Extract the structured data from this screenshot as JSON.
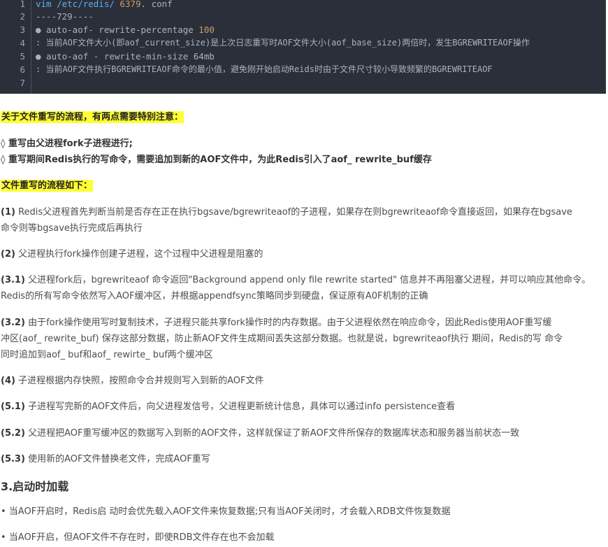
{
  "code": {
    "lines": [
      {
        "no": "1",
        "cmd": "vim /etc/redis/ ",
        "num": "6379",
        "rest": ". conf"
      },
      {
        "no": "2",
        "text": "----729----"
      },
      {
        "no": "3",
        "pre": "● auto-aof- rewrite-percentage ",
        "num": "100"
      },
      {
        "no": "4",
        "text": ": 当前AOF文件大小(即aof_current_size)是上次日志重写时AOF文件大小(aof_base_size)两倍时，发生BGREWRITEAOF操作"
      },
      {
        "no": "5",
        "text": "● auto-aof - rewrite-min-size 64mb"
      },
      {
        "no": "6",
        "text": ": 当前AOF文件执行BGREWRITEAOF命令的最小值，避免刚开始启动Reids时由于文件尺寸较小导致频繁的BGREWRITEAOF"
      },
      {
        "no": "7",
        "text": ""
      }
    ]
  },
  "notice_heading": "关于文件重写的流程，有两点需要特别注意：",
  "notice_items": [
    "◊ 重写由父进程fork子进程进行;",
    "◊ 重写期间Redis执行的写命令，需要追加到新的AOF文件中，为此Redis引入了aof_ rewrite_buf缓存"
  ],
  "flow_heading": "文件重写的流程如下：",
  "steps": [
    {
      "num": "(1)",
      "lines": [
        "Redis父进程首先判断当前是否存在正在执行bgsave/bgrewriteaof的子进程，如果存在则bgrewriteaof命令直接返回，如果存在bgsave",
        "命令则等bgsave执行完成后再执行"
      ]
    },
    {
      "num": "(2)",
      "lines": [
        "父进程执行fork操作创建子进程，这个过程中父进程是阻塞的"
      ]
    },
    {
      "num": "(3.1)",
      "lines": [
        "父进程fork后，bgrewriteaof 命令返回\"Background append only file rewrite started\" 信息并不再阻塞父进程，并可以响应其他命令。",
        "Redis的所有写命令依然写入AOF缓冲区，并根据appendfsync策略同步到硬盘，保证原有A0F机制的正确"
      ]
    },
    {
      "num": "(3.2)",
      "lines": [
        "由于fork操作使用写时复制技术，子进程只能共享fork操作时的内存数据。由于父进程依然在响应命令，因此Redis使用AOF重写缓",
        "冲区(aof_ rewrite_buf) 保存这部分数据，防止新AOF文件生成期间丢失这部分数据。也就是说，bgrewriteaof执行 期间，Redis的写 命令",
        "同时追加到aof_ buf和aof_ rewirte_ buf两个缓冲区"
      ]
    },
    {
      "num": "(4)",
      "lines": [
        "子进程根据内存快照，按照命令合并规则写入到新的AOF文件"
      ]
    },
    {
      "num": "(5.1)",
      "lines": [
        "子进程写完新的AOF文件后，向父进程发信号，父进程更新统计信息，具体可以通过info persistence查看"
      ]
    },
    {
      "num": "(5.2)",
      "lines": [
        "父进程把AOF重写缓冲区的数据写入到新的AOF文件，这样就保证了新AOF文件所保存的数据库状态和服务器当前状态一致"
      ]
    },
    {
      "num": "(5.3)",
      "lines": [
        "使用新的AOF文件替换老文件，完成AOF重写"
      ]
    }
  ],
  "section_title": "3.启动时加载",
  "bullets": [
    "• 当AOF开启时，Redis启 动时会优先载入AOF文件来恢复数据;只有当AOF关闭时，才会载入RDB文件恢复数据",
    "• 当AOF开启，但AOF文件不存在时，即使RDB文件存在也不会加载"
  ]
}
